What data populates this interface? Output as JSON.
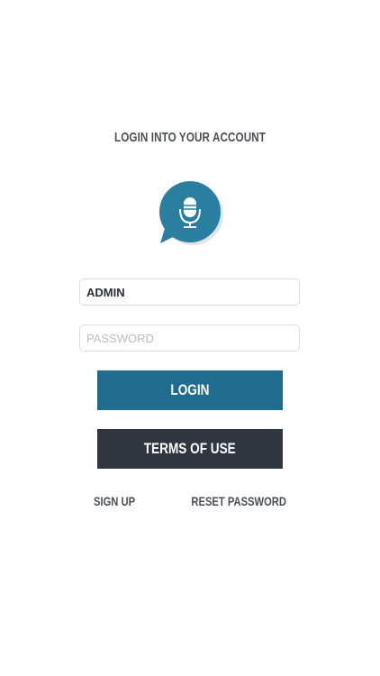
{
  "login": {
    "title": "LOGIN INTO YOUR ACCOUNT",
    "username_value": "ADMIN",
    "password_placeholder": "PASSWORD",
    "login_label": "LOGIN",
    "terms_label": "TERMS OF USE",
    "signup_label": "SIGN UP",
    "reset_label": "RESET PASSWORD"
  },
  "logo": {
    "icon": "microphone-chat-bubble-icon",
    "bubble_color": "#2a7fa1",
    "mic_color": "#ffffff"
  },
  "colors": {
    "login_button": "#1f6c8f",
    "terms_button": "#2f363f",
    "text": "#4b4f55"
  }
}
